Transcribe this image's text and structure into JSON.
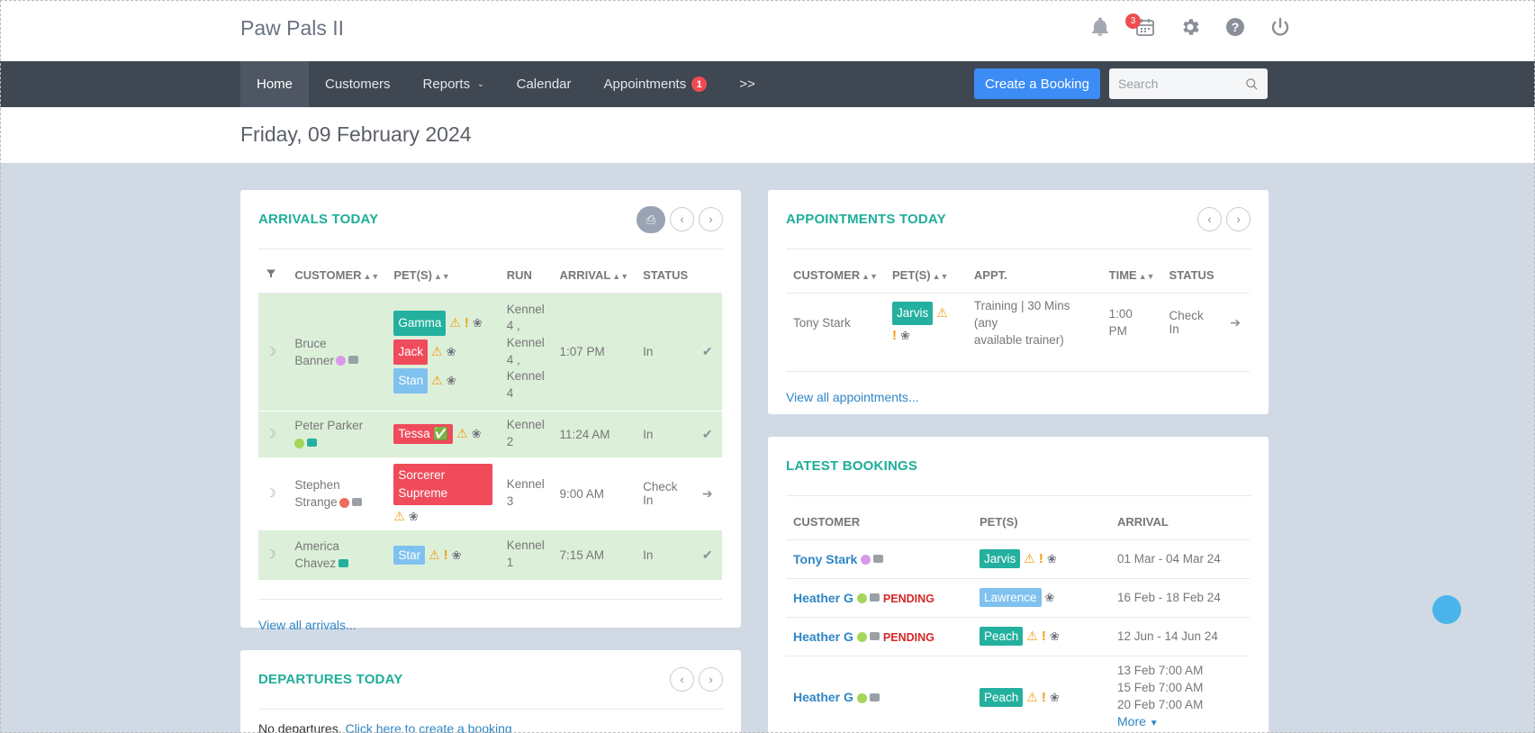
{
  "app": {
    "title": "Paw Pals II",
    "notification_count": "3"
  },
  "nav": {
    "items": [
      {
        "label": "Home"
      },
      {
        "label": "Customers"
      },
      {
        "label": "Reports"
      },
      {
        "label": "Calendar"
      },
      {
        "label": "Appointments",
        "badge": "1"
      },
      {
        "label": ">>"
      }
    ],
    "create_label": "Create a Booking",
    "search_placeholder": "Search"
  },
  "date": "Friday, 09 February 2024",
  "arrivals": {
    "title": "ARRIVALS TODAY",
    "headers": [
      "CUSTOMER",
      "PET(S)",
      "RUN",
      "ARRIVAL",
      "STATUS"
    ],
    "rows": [
      {
        "customer_line1": "Bruce",
        "customer_line2": "Banner",
        "run": [
          "Kennel",
          "4 ,",
          "Kennel",
          "4 ,",
          "Kennel",
          "4"
        ],
        "arrival": "1:07 PM",
        "status": "In",
        "pets": [
          "Gamma",
          "Jack",
          "Stan"
        ]
      },
      {
        "customer_line1": "Peter Parker",
        "customer_line2": "",
        "run": [
          "Kennel",
          "2"
        ],
        "arrival": "11:24 AM",
        "status": "In",
        "pets": [
          "Tessa ✅"
        ]
      },
      {
        "customer_line1": "Stephen",
        "customer_line2": "Strange",
        "run": [
          "Kennel",
          "3"
        ],
        "arrival": "9:00 AM",
        "status": "Check In",
        "pets": [
          "Sorcerer Supreme"
        ]
      },
      {
        "customer_line1": "America",
        "customer_line2": "Chavez",
        "run": [
          "Kennel",
          "1"
        ],
        "arrival": "7:15 AM",
        "status": "In",
        "pets": [
          "Star"
        ]
      }
    ],
    "view_all": "View all arrivals..."
  },
  "departures": {
    "title": "DEPARTURES TODAY",
    "empty_text": "No departures.",
    "create_link": "Click here to create a booking"
  },
  "appointments": {
    "title": "APPOINTMENTS TODAY",
    "headers": [
      "CUSTOMER",
      "PET(S)",
      "APPT.",
      "TIME",
      "STATUS"
    ],
    "row": {
      "customer": "Tony Stark",
      "pet": "Jarvis",
      "appt_line1": "Training | 30 Mins (any",
      "appt_line2": "available trainer)",
      "time_line1": "1:00",
      "time_line2": "PM",
      "status": "Check In"
    },
    "view_all": "View all appointments..."
  },
  "latest": {
    "title": "LATEST BOOKINGS",
    "headers": [
      "CUSTOMER",
      "PET(S)",
      "ARRIVAL"
    ],
    "rows": [
      {
        "customer": "Tony Stark",
        "pending": "",
        "pet": "Jarvis",
        "arrival": "01 Mar - 04 Mar 24"
      },
      {
        "customer": "Heather G",
        "pending": "PENDING",
        "pet": "Lawrence",
        "arrival": "16 Feb - 18 Feb 24"
      },
      {
        "customer": "Heather G",
        "pending": "PENDING",
        "pet": "Peach",
        "arrival": "12 Jun - 14 Jun 24"
      },
      {
        "customer": "Heather G",
        "pending": "",
        "pet": "Peach",
        "arrival_lines": [
          "13 Feb 7:00 AM",
          "15 Feb 7:00 AM",
          "20 Feb 7:00 AM"
        ],
        "more": "More"
      }
    ]
  },
  "colors": {
    "accent": "#1fae9a",
    "nav_bg": "#3f4752",
    "primary": "#3b8cf5",
    "row_green": "#dcf0d9",
    "pending": "#d62728"
  }
}
